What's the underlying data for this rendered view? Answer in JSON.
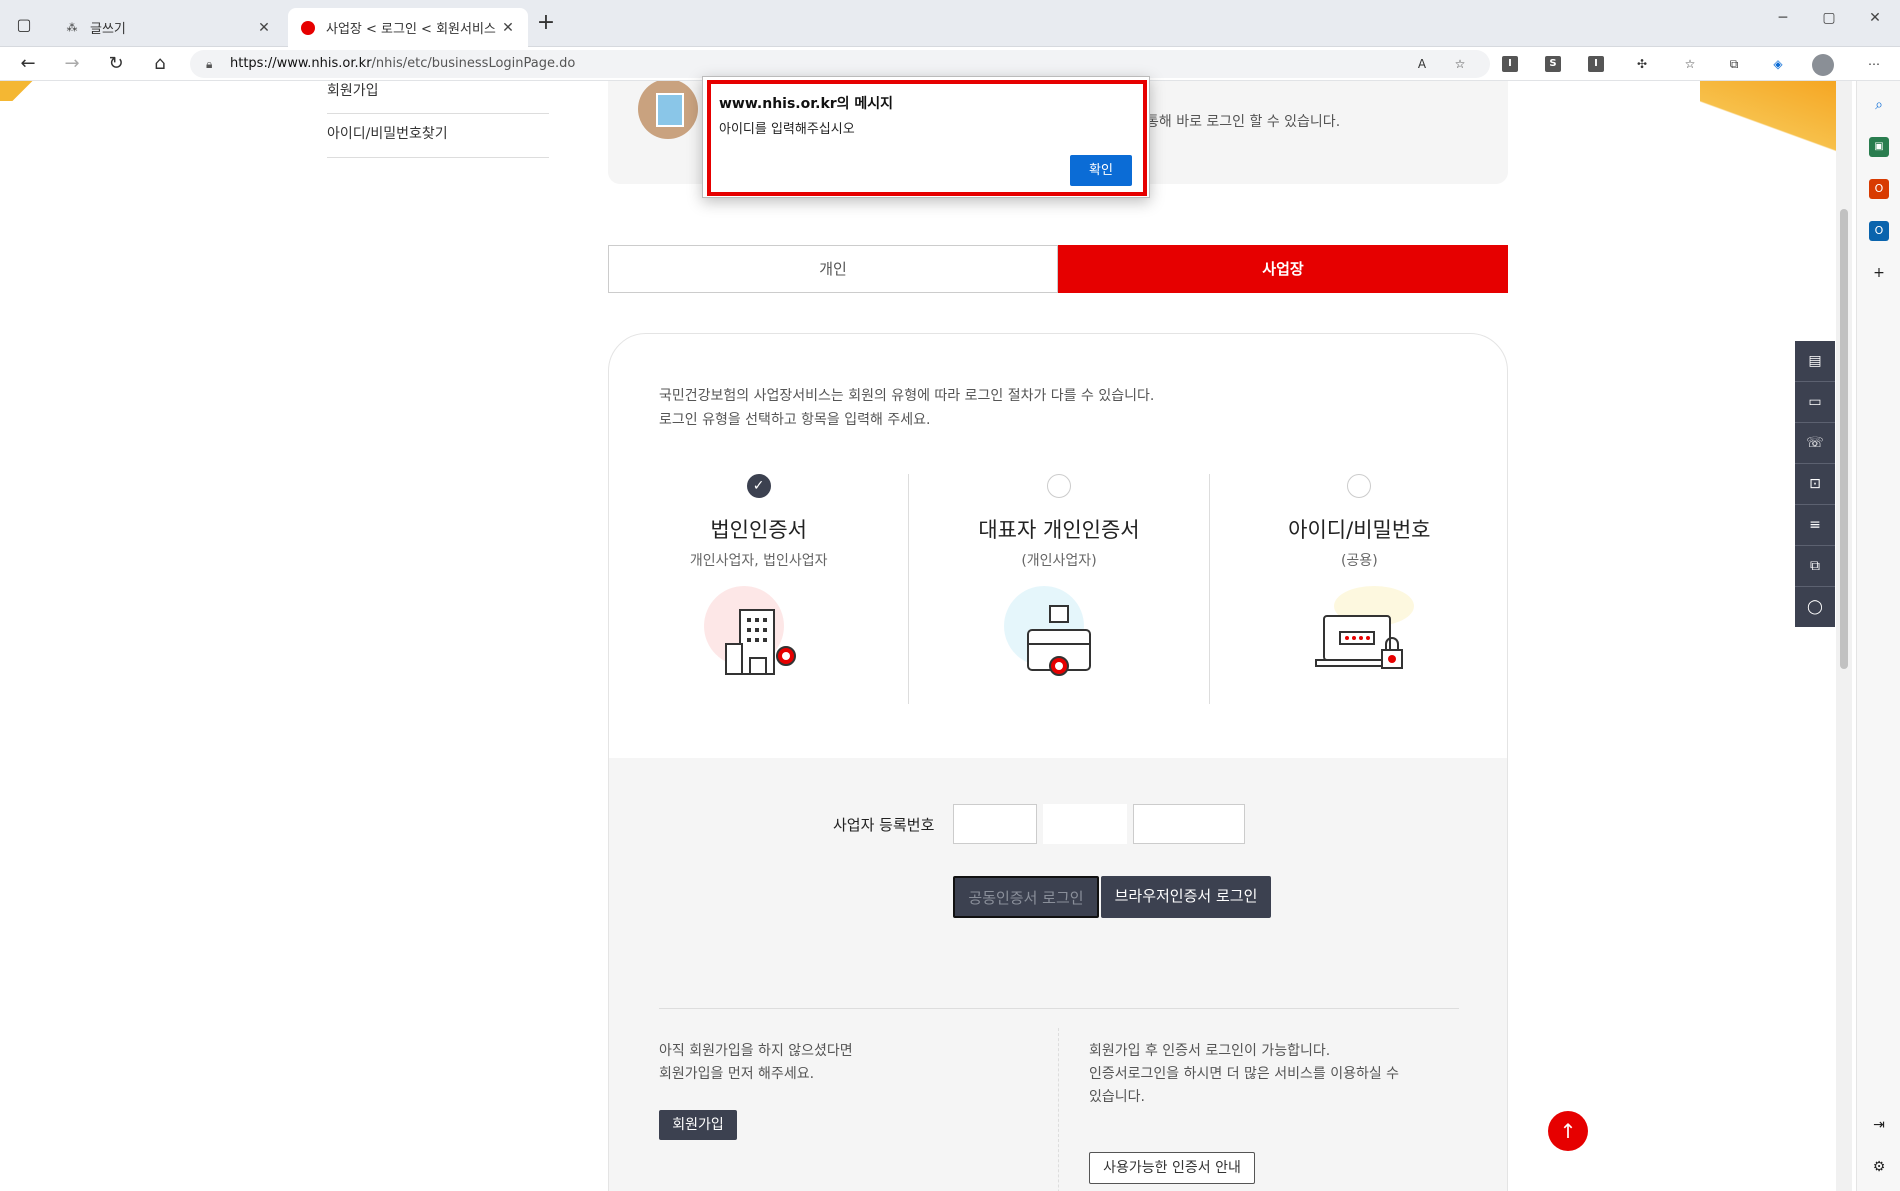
{
  "browser": {
    "tabs": [
      {
        "title": "글쓰기",
        "active": false
      },
      {
        "title": "사업장 < 로그인 < 회원서비스 <",
        "active": true
      }
    ],
    "url_host": "https://www.nhis.or.kr",
    "url_path": "/nhis/etc/businessLoginPage.do",
    "toolbar_ext": [
      "I",
      "S",
      "I"
    ]
  },
  "leftnav": [
    "회원가입",
    "아이디/비밀번호찾기"
  ],
  "infobox_text": "통해 바로 로그인 할 수 있습니다.",
  "segment": {
    "personal": "개인",
    "business": "사업장"
  },
  "intro": [
    "국민건강보험의 사업장서비스는 회원의 유형에 따라 로그인 절차가 다를 수 있습니다.",
    "로그인 유형을 선택하고 항목을 입력해 주세요."
  ],
  "login_types": [
    {
      "name": "법인인증서",
      "sub": "개인사업자, 법인사업자",
      "checked": true
    },
    {
      "name": "대표자 개인인증서",
      "sub": "(개인사업자)",
      "checked": false
    },
    {
      "name": "아이디/비밀번호",
      "sub": "(공용)",
      "checked": false
    }
  ],
  "form": {
    "biz_label": "사업자 등록번호",
    "btn_public": "공동인증서 로그인",
    "btn_browser": "브라우저인증서 로그인"
  },
  "bottom": {
    "left_lines": [
      "아직 회원가입을 하지 않으셨다면",
      "회원가입을 먼저 해주세요."
    ],
    "signup_btn": "회원가입",
    "right_lines": [
      "회원가입 후 인증서 로그인이 가능합니다.",
      "인증서로그인을 하시면 더 많은 서비스를 이용하실 수",
      "있습니다."
    ],
    "cert_btn": "사용가능한 인증서 안내"
  },
  "dialog": {
    "title": "www.nhis.or.kr의 메시지",
    "message": "아이디를 입력해주십시오",
    "ok": "확인"
  },
  "colors": {
    "brand_red": "#e60000",
    "dark": "#3c4150",
    "dialog_blue": "#0b6cd6"
  }
}
